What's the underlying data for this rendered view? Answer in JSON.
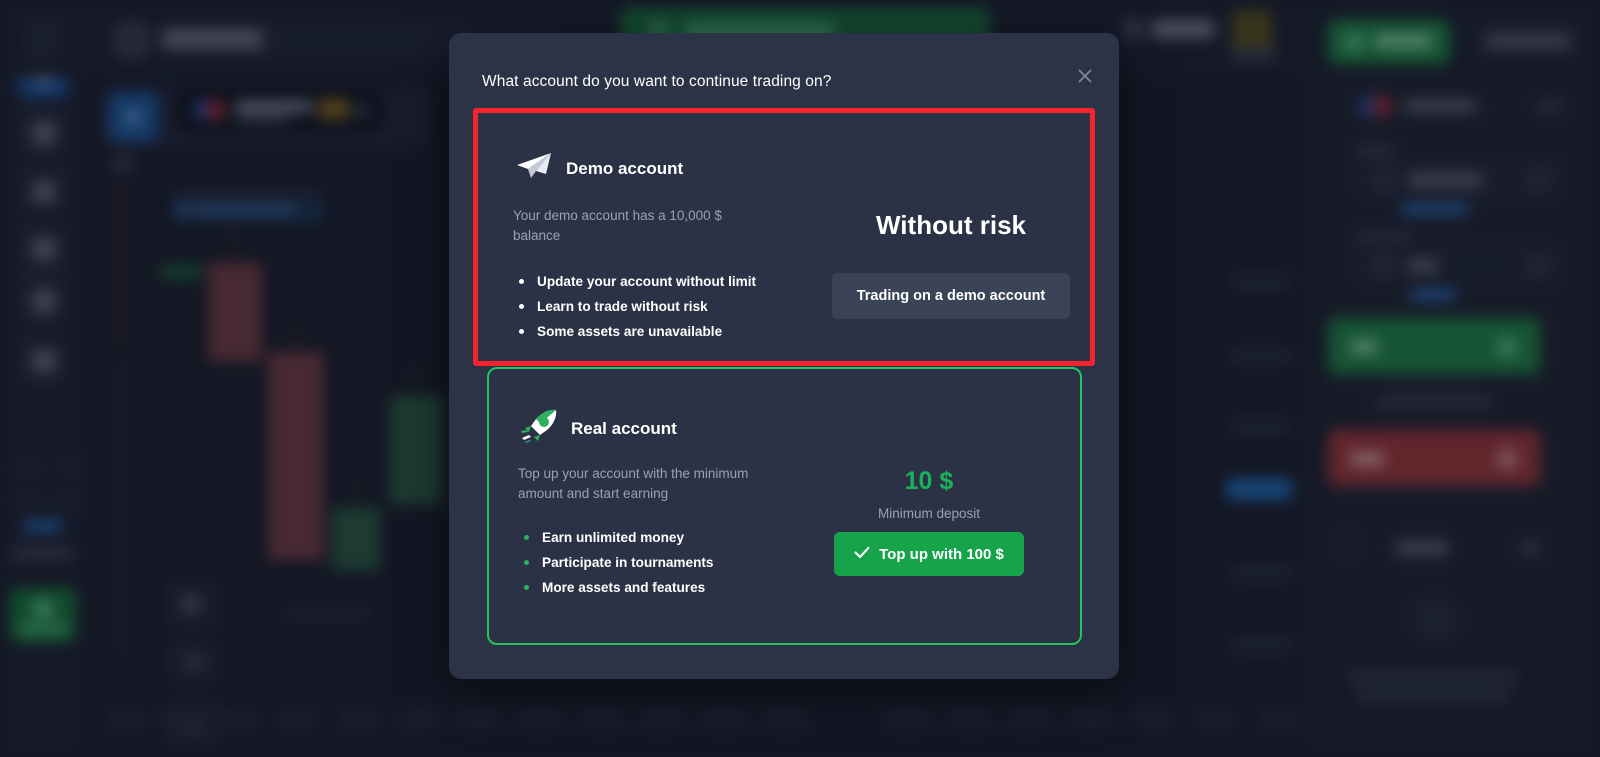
{
  "modal": {
    "title": "What account do you want to continue trading on?",
    "close_icon": "close-icon",
    "demo": {
      "icon": "paper-plane-icon",
      "heading": "Demo account",
      "subtitle": "Your demo account has a 10,000 $ balance",
      "features": [
        "Update your account without limit",
        "Learn to trade without risk",
        "Some assets are unavailable"
      ],
      "highlight": "Without risk",
      "button_label": "Trading on a demo account",
      "highlight_border_color": "#f5232e"
    },
    "real": {
      "icon": "rocket-icon",
      "heading": "Real account",
      "subtitle": "Top up your account with the minimum amount and start earning",
      "features": [
        "Earn unlimited money",
        "Participate in tournaments",
        "More assets and features"
      ],
      "amount": "10 $",
      "amount_caption": "Minimum deposit",
      "button_icon": "check-icon",
      "button_label": "Top up with 100 $",
      "border_color": "#22c55e",
      "accent_color": "#16a34a"
    }
  },
  "colors": {
    "modal_bg": "#2c3346",
    "card_bg": "#2b3245",
    "app_bg": "#1b2030",
    "panel_bg": "#1e2436",
    "text_primary": "#ffffff",
    "text_muted": "#9aa1b3",
    "green": "#19b259",
    "red": "#f5232e"
  }
}
